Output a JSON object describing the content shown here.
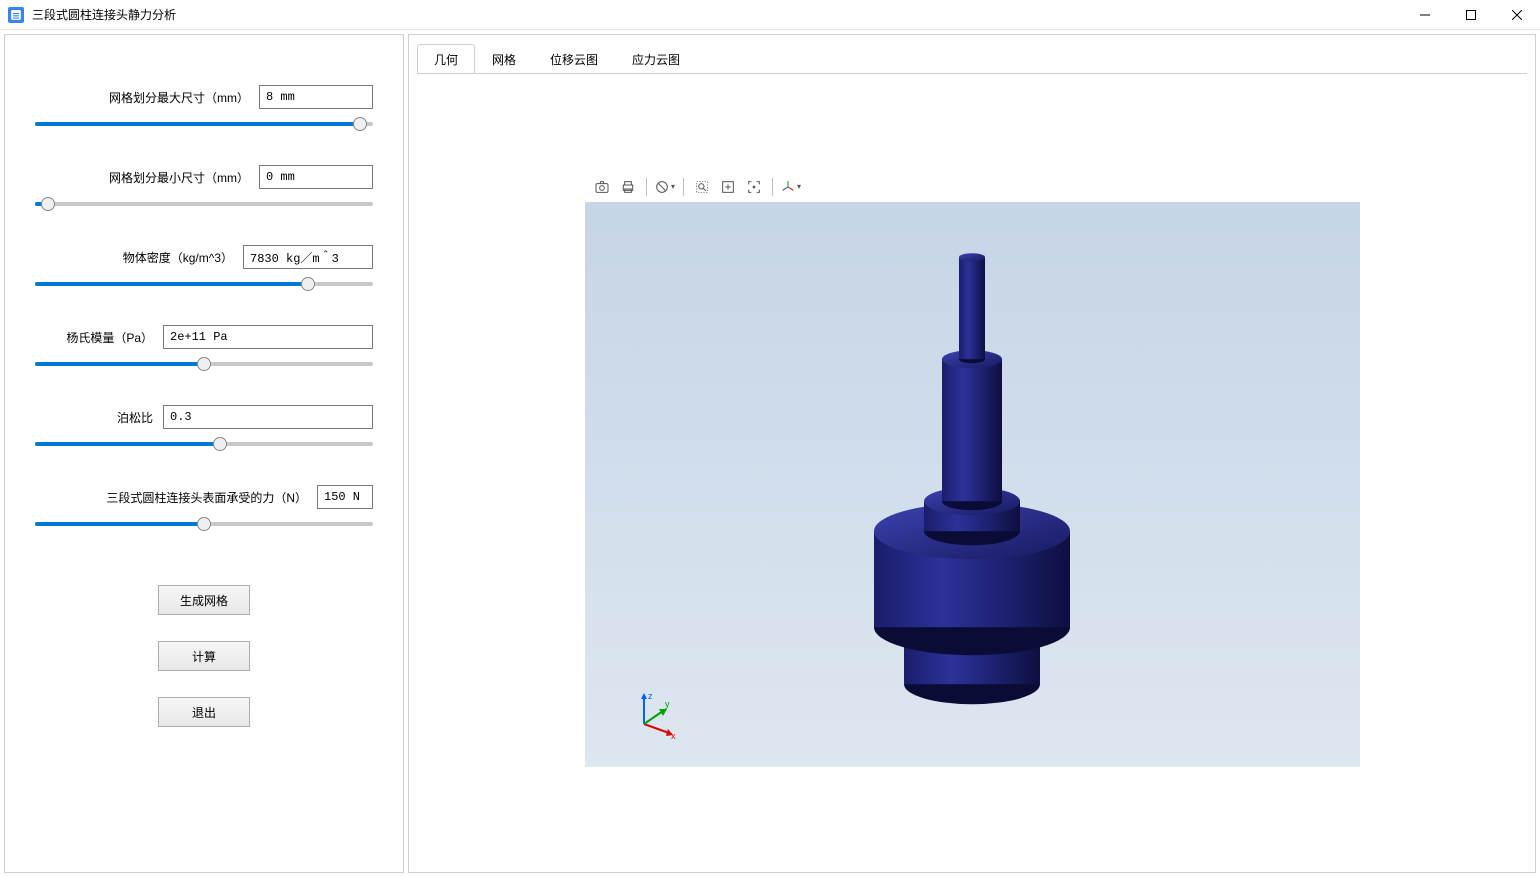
{
  "window": {
    "title": "三段式圆柱连接头静力分析"
  },
  "params": {
    "mesh_max": {
      "label": "网格划分最大尺寸（mm）",
      "value": "8 mm",
      "slider_pct": 98
    },
    "mesh_min": {
      "label": "网格划分最小尺寸（mm）",
      "value": "0 mm",
      "slider_pct": 2
    },
    "density": {
      "label": "物体密度（kg/m^3）",
      "value": "7830 kg／m＾3",
      "slider_pct": 82
    },
    "youngs": {
      "label": "杨氏模量（Pa）",
      "value": "2e+11 Pa",
      "slider_pct": 50
    },
    "poisson": {
      "label": "泊松比",
      "value": "0.3",
      "slider_pct": 55
    },
    "force": {
      "label": "三段式圆柱连接头表面承受的力（N）",
      "value": "150 N",
      "slider_pct": 50
    }
  },
  "buttons": {
    "mesh": "生成网格",
    "compute": "计算",
    "exit": "退出"
  },
  "tabs": {
    "geometry": "几何",
    "mesh": "网格",
    "displacement": "位移云图",
    "stress": "应力云图"
  }
}
